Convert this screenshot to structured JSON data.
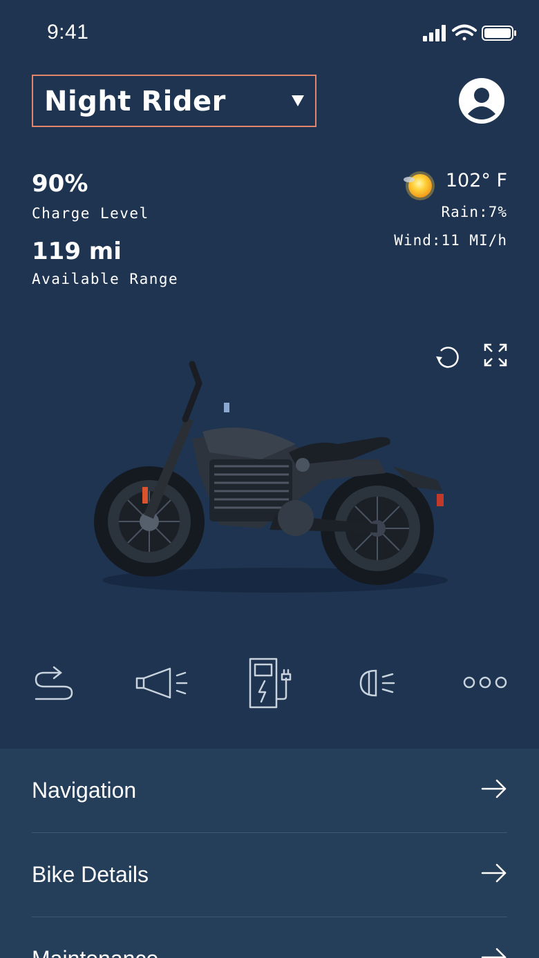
{
  "status_bar": {
    "time": "9:41",
    "icons": [
      "signal-icon",
      "wifi-icon",
      "battery-icon"
    ]
  },
  "header": {
    "bike_name": "Night Rider",
    "selector_border_color": "#e3846d",
    "profile_icon": "user-avatar-icon"
  },
  "stats": {
    "charge_value": "90%",
    "charge_label": "Charge Level",
    "range_value": "119 mi",
    "range_label": "Available Range"
  },
  "weather": {
    "icon": "sun-icon",
    "temperature": "102° F",
    "rain": "Rain:7%",
    "wind": "Wind:11 MI/h"
  },
  "bike_view": {
    "controls": [
      "rotate-icon",
      "fullscreen-icon"
    ],
    "image": "motorcycle-image"
  },
  "quick_actions": [
    {
      "name": "route-icon"
    },
    {
      "name": "horn-icon"
    },
    {
      "name": "charging-station-icon"
    },
    {
      "name": "headlight-icon"
    },
    {
      "name": "more-icon"
    }
  ],
  "menu": {
    "items": [
      {
        "label": "Navigation"
      },
      {
        "label": "Bike Details"
      },
      {
        "label": "Maintenance"
      }
    ]
  },
  "colors": {
    "background": "#1e3450",
    "menu_background": "#253f5b",
    "accent": "#e3846d"
  }
}
